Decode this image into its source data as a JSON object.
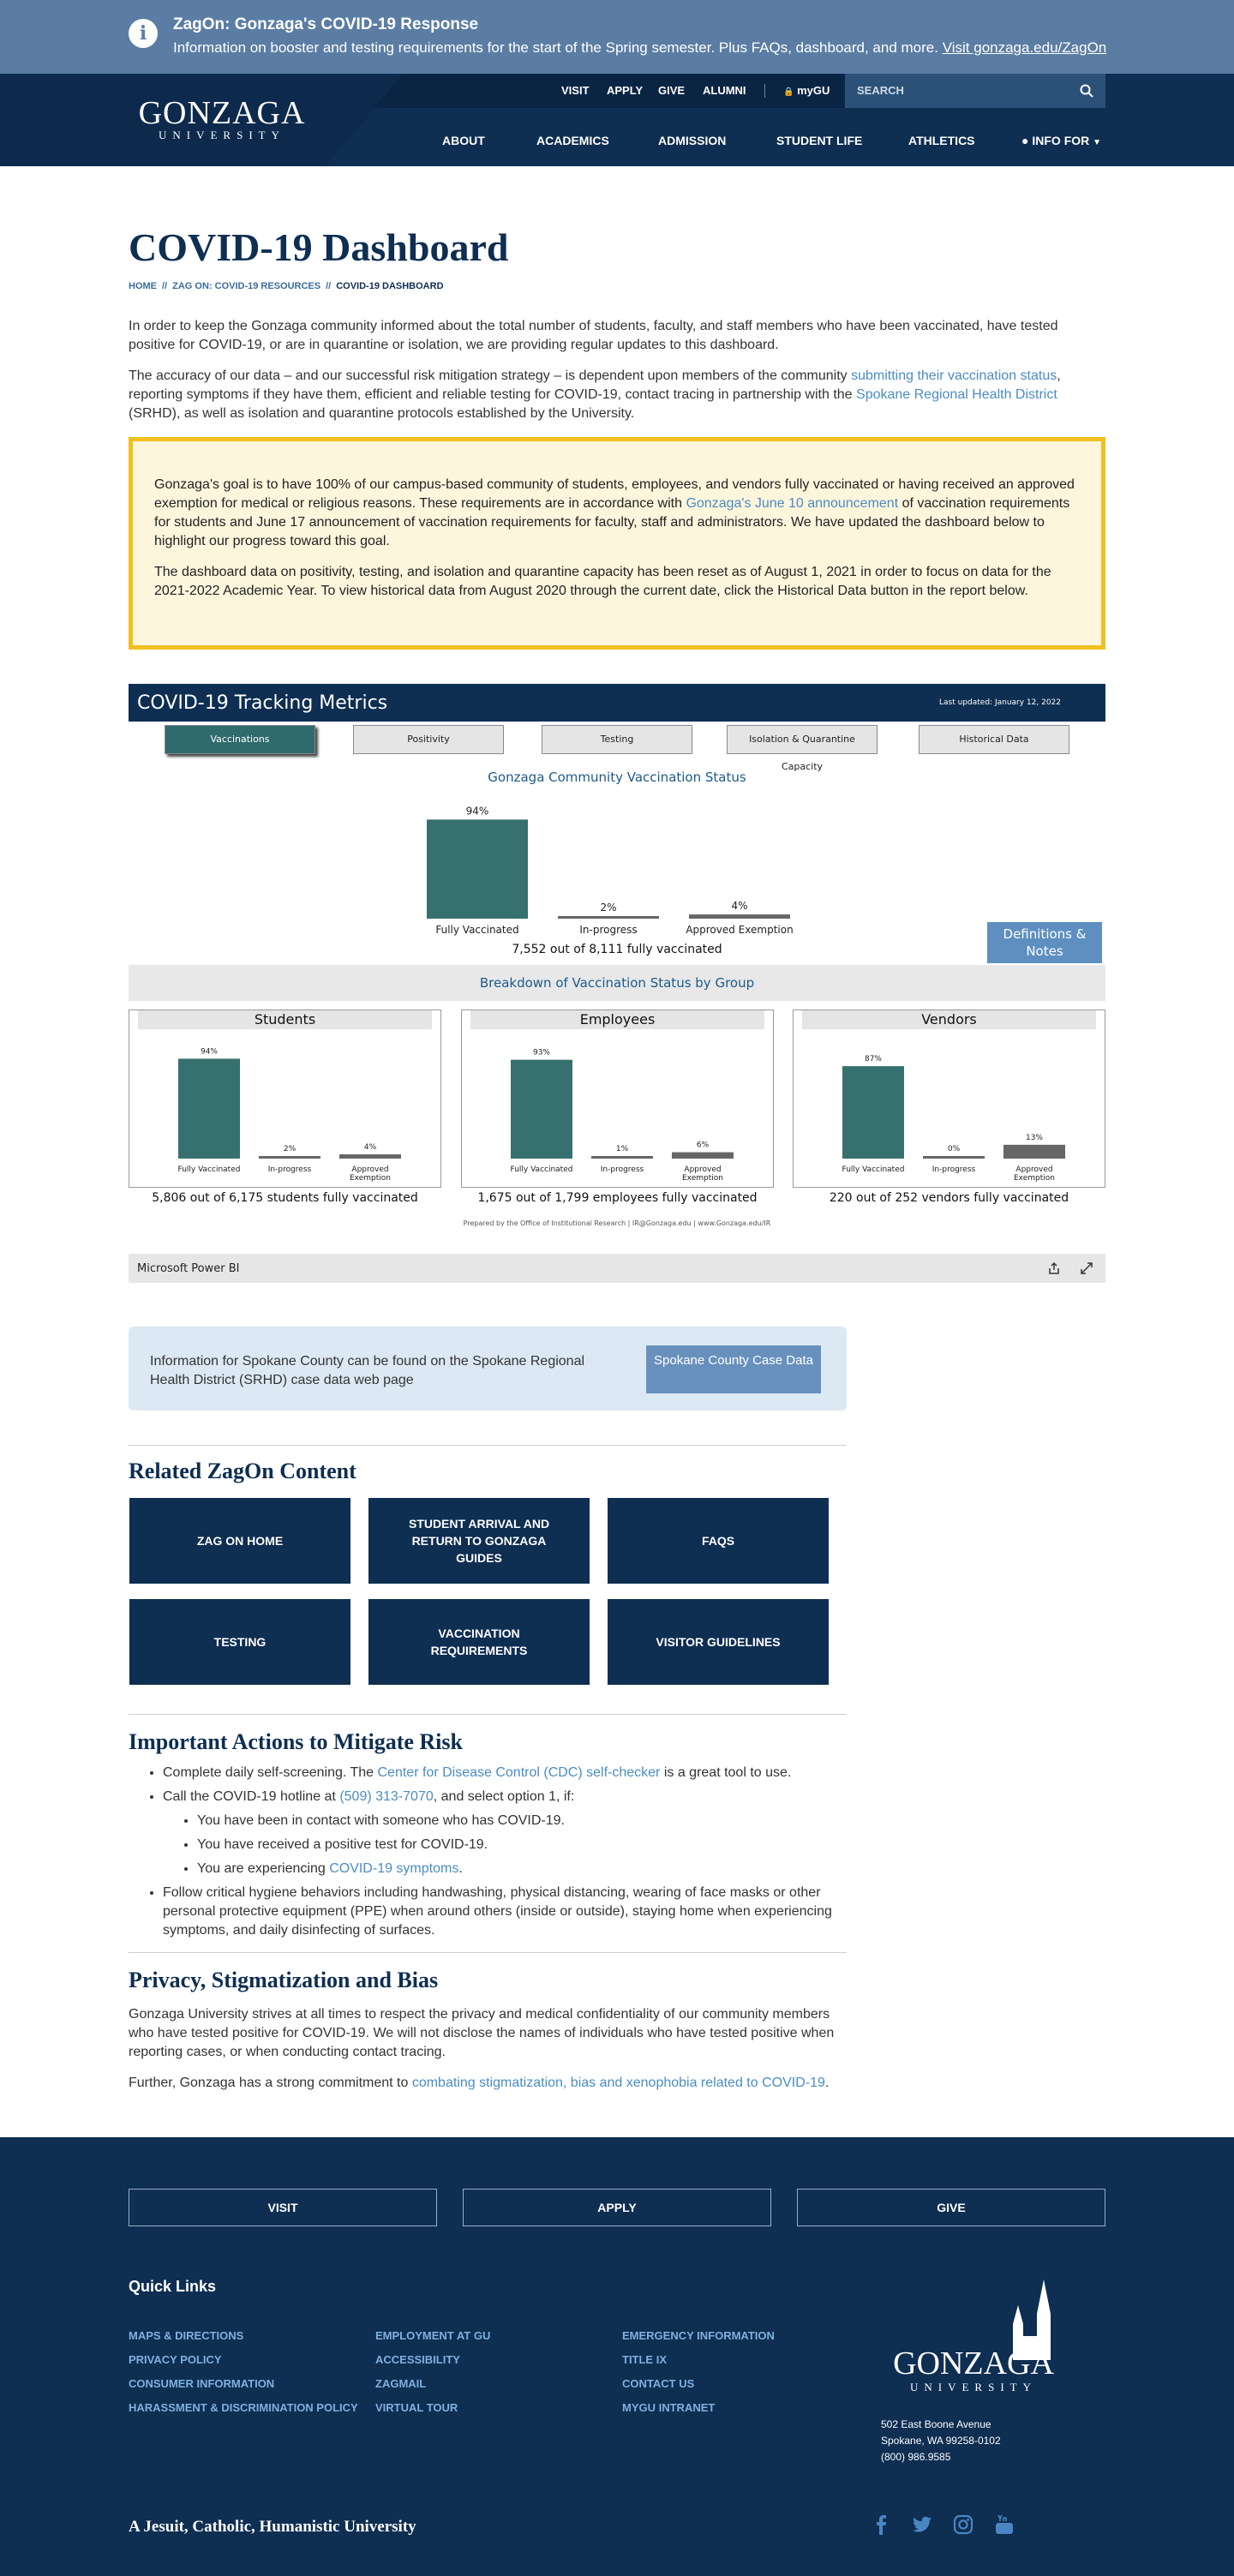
{
  "alert": {
    "title": "ZagOn: Gonzaga's COVID-19 Response",
    "text": "Information on booster and testing requirements for the start of the Spring semester. Plus FAQs, dashboard, and more. ",
    "link": "Visit gonzaga.edu/ZagOn"
  },
  "header": {
    "logo_main": "GONZAGA",
    "logo_sub": "UNIVERSITY",
    "utility": [
      "VISIT",
      "APPLY",
      "GIVE",
      "ALUMNI"
    ],
    "mygu": "myGU",
    "search_placeholder": "SEARCH",
    "nav": [
      "ABOUT",
      "ACADEMICS",
      "ADMISSION",
      "STUDENT LIFE",
      "ATHLETICS"
    ],
    "info_for": "INFO FOR"
  },
  "page": {
    "title": "COVID-19 Dashboard",
    "breadcrumb": [
      "HOME",
      "ZAG ON: COVID-19 RESOURCES",
      "COVID-19 DASHBOARD"
    ],
    "intro": "In order to keep the Gonzaga community informed about the total number of students, faculty, and staff members who have been vaccinated, have tested positive for COVID-19, or are in quarantine or isolation, we are providing regular updates to this dashboard.",
    "p2_a": "The accuracy of our data –  and our successful risk mitigation strategy – is dependent upon members of the community ",
    "p2_link1": "submitting their vaccination status",
    "p2_b": ", reporting symptoms if they have them, efficient and reliable testing for COVID-19, contact tracing in partnership with the ",
    "p2_link2": "Spokane Regional Health District",
    "p2_c": " (SRHD), as well as isolation and quarantine protocols established by the University.",
    "notice1_a": "Gonzaga's goal is to have 100% of our campus-based community of students, employees, and vendors fully vaccinated or having received an approved exemption for medical or religious reasons. These requirements are in accordance with ",
    "notice1_link": "Gonzaga's June 10 announcement",
    "notice1_b": " of vaccination requirements for students and June 17 announcement of vaccination requirements for faculty, staff and administrators. We have updated the dashboard below to highlight our progress toward this goal.",
    "notice2": "The dashboard data on positivity, testing, and isolation and quarantine capacity has been reset as of August 1, 2021 in order to focus on data for the 2021-2022 Academic Year. To view historical data from August 2020 through the current date, click the Historical Data button in the report below."
  },
  "dashboard": {
    "title": "COVID-19 Tracking Metrics",
    "updated": "Last updated: January 12, 2022",
    "tabs": [
      "Vaccinations",
      "Positivity",
      "Testing",
      "Isolation & Quarantine Capacity",
      "Historical Data"
    ],
    "main_title": "Gonzaga Community Vaccination Status",
    "main_caption": "7,552 out of 8,111 fully vaccinated",
    "definitions": "Definitions & Notes",
    "breakdown_title": "Breakdown of Vaccination Status by Group",
    "prepared": "Prepared by the Office of Institutional Research | IR@Gonzaga.edu | www.Gonzaga.edu/IR",
    "footer_brand": "Microsoft Power BI",
    "colors": {
      "fully": "#36706f",
      "other": "#666666"
    }
  },
  "chart_data": [
    {
      "type": "bar",
      "title": "Gonzaga Community Vaccination Status",
      "categories": [
        "Fully Vaccinated",
        "In-progress",
        "Approved Exemption"
      ],
      "values": [
        94,
        2,
        4
      ],
      "labels": [
        "94%",
        "2%",
        "4%"
      ],
      "ylim": [
        0,
        100
      ]
    },
    {
      "type": "bar",
      "title": "Students",
      "categories": [
        "Fully Vaccinated",
        "In-progress",
        "Approved Exemption"
      ],
      "values": [
        94,
        2,
        4
      ],
      "labels": [
        "94%",
        "2%",
        "4%"
      ],
      "caption": "5,806 out of 6,175 students fully vaccinated",
      "ylim": [
        0,
        100
      ]
    },
    {
      "type": "bar",
      "title": "Employees",
      "categories": [
        "Fully Vaccinated",
        "In-progress",
        "Approved Exemption"
      ],
      "values": [
        93,
        1,
        6
      ],
      "labels": [
        "93%",
        "1%",
        "6%"
      ],
      "caption": "1,675 out of 1,799 employees fully vaccinated",
      "ylim": [
        0,
        100
      ]
    },
    {
      "type": "bar",
      "title": "Vendors",
      "categories": [
        "Fully Vaccinated",
        "In-progress",
        "Approved Exemption"
      ],
      "values": [
        87,
        0,
        13
      ],
      "labels": [
        "87%",
        "0%",
        "13%"
      ],
      "caption": "220 out of 252 vendors fully vaccinated",
      "ylim": [
        0,
        100
      ]
    }
  ],
  "county": {
    "text": "Information for Spokane County can be found on the Spokane Regional Health District (SRHD) case data web page",
    "button": "Spokane County Case Data"
  },
  "related": {
    "title": "Related ZagOn Content",
    "tiles": [
      "ZAG ON HOME",
      "STUDENT ARRIVAL AND RETURN TO GONZAGA GUIDES",
      "FAQS",
      "TESTING",
      "VACCINATION REQUIREMENTS",
      "VISITOR GUIDELINES"
    ]
  },
  "actions": {
    "title": "Important Actions to Mitigate Risk",
    "b1_a": "Complete daily self-screening. The ",
    "b1_link": "Center for Disease Control (CDC) self-checker",
    "b1_b": " is a great tool to use.",
    "b2_a": "Call the COVID-19 hotline at ",
    "b2_link": "(509) 313-7070",
    "b2_b": ", and select option 1, if:",
    "sub1": "You have been in contact with someone who has COVID-19.",
    "sub2": "You have received a positive test for COVID-19.",
    "sub3_a": "You are experiencing ",
    "sub3_link": "COVID-19 symptoms",
    "sub3_b": ".",
    "b3": "Follow critical hygiene behaviors including handwashing, physical distancing, wearing of face masks or other personal protective equipment (PPE) when around others (inside or outside), staying home when experiencing symptoms, and daily disinfecting of surfaces."
  },
  "privacy": {
    "title": "Privacy, Stigmatization and Bias",
    "p1": "Gonzaga University strives at all times to respect the privacy and medical confidentiality of our community members who have tested positive for COVID-19. We will not disclose the names of individuals who have tested positive when reporting cases, or when conducting contact tracing.",
    "p2_a": "Further, Gonzaga has a strong commitment to ",
    "p2_link": "combating stigmatization, bias and xenophobia related to COVID-19",
    "p2_b": "."
  },
  "footer": {
    "buttons": [
      "VISIT",
      "APPLY",
      "GIVE"
    ],
    "quick_links_title": "Quick Links",
    "col1": [
      "MAPS & DIRECTIONS",
      "PRIVACY POLICY",
      "CONSUMER INFORMATION",
      "HARASSMENT & DISCRIMINATION POLICY"
    ],
    "col2": [
      "EMPLOYMENT AT GU",
      "ACCESSIBILITY",
      "ZAGMAIL",
      "VIRTUAL TOUR"
    ],
    "col3": [
      "EMERGENCY INFORMATION",
      "TITLE IX",
      "CONTACT US",
      "MYGU INTRANET"
    ],
    "logo_main": "GONZAGA",
    "logo_sub": "UNIVERSITY",
    "address1": "502 East Boone Avenue",
    "address2": "Spokane, WA 99258-0102",
    "phone": "(800) 986.9585",
    "tagline": "A Jesuit, Catholic, Humanistic University",
    "social": [
      "facebook-icon",
      "twitter-icon",
      "instagram-icon",
      "youtube-icon"
    ]
  }
}
